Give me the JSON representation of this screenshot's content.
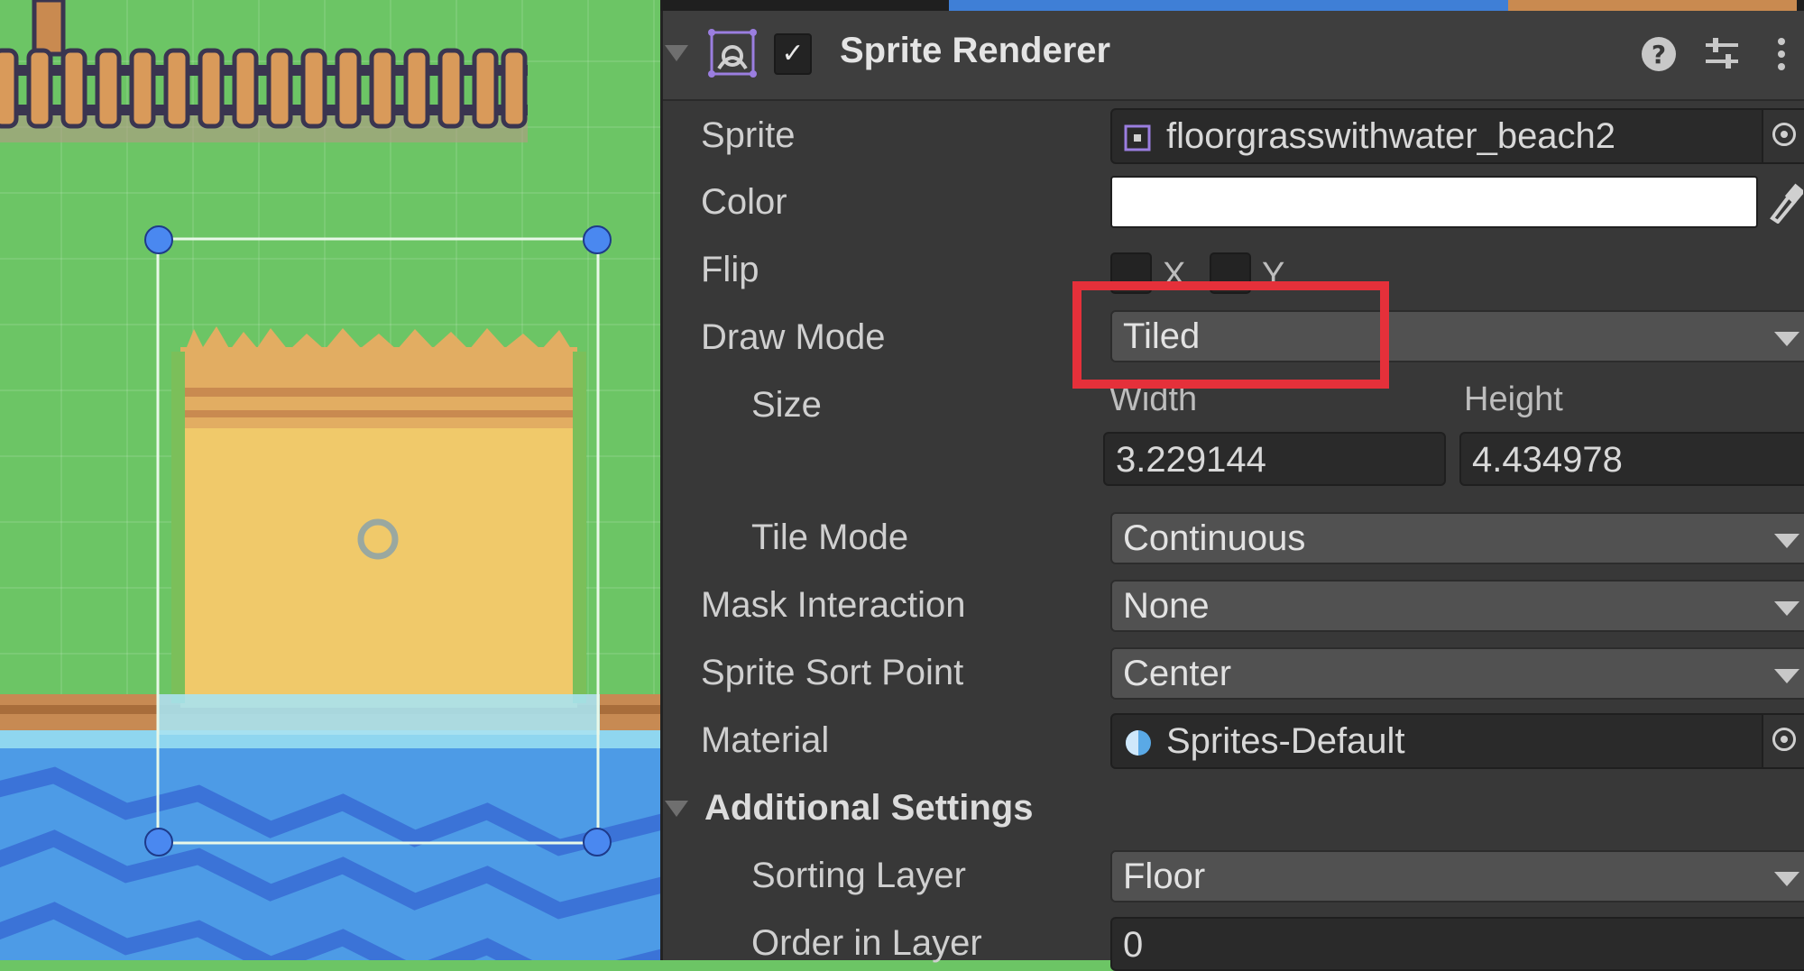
{
  "component": {
    "title": "Sprite Renderer",
    "enabled_check": "✓",
    "icon": "sprite-renderer-icon",
    "buttons": [
      "help-icon",
      "preset-icon",
      "more-options-icon"
    ]
  },
  "fields": {
    "sprite": {
      "label": "Sprite",
      "value": "floorgrasswithwater_beach2",
      "icon": "sprite-asset-icon"
    },
    "color": {
      "label": "Color",
      "value": "#ffffff"
    },
    "flip": {
      "label": "Flip",
      "x_label": "X",
      "y_label": "Y",
      "x_checked": false,
      "y_checked": false
    },
    "draw_mode": {
      "label": "Draw Mode",
      "value": "Tiled"
    },
    "size": {
      "label": "Size",
      "width_label": "Width",
      "height_label": "Height",
      "width": "3.229144",
      "height": "4.434978"
    },
    "tile_mode": {
      "label": "Tile Mode",
      "value": "Continuous"
    },
    "mask_interaction": {
      "label": "Mask Interaction",
      "value": "None"
    },
    "sprite_sort_point": {
      "label": "Sprite Sort Point",
      "value": "Center"
    },
    "material": {
      "label": "Material",
      "value": "Sprites-Default",
      "icon": "material-icon"
    }
  },
  "additional_settings": {
    "title": "Additional Settings",
    "sorting_layer": {
      "label": "Sorting Layer",
      "value": "Floor"
    },
    "order_in_layer": {
      "label": "Order in Layer",
      "value": "0"
    }
  },
  "colors": {
    "inspector_bg": "#383838",
    "grass": "#6cc565",
    "sand": "#f0c96a",
    "water": "#4d9be6",
    "highlight": "#e5303a",
    "handle": "#4a88f0"
  }
}
